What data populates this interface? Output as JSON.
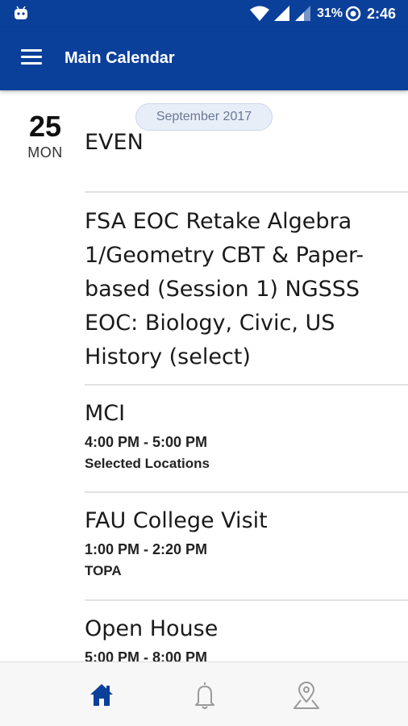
{
  "status_bar": {
    "battery": "31%",
    "time": "2:46"
  },
  "app_bar": {
    "title": "Main Calendar"
  },
  "calendar": {
    "month_label": "September 2017",
    "day": {
      "number": "25",
      "weekday": "MON"
    },
    "events": [
      {
        "title": "EVEN"
      },
      {
        "title": "FSA EOC Retake Algebra 1/Geometry CBT & Paper-based (Session 1) NGSSS EOC: Biology, Civic, US History (select)"
      },
      {
        "title": "MCI",
        "time": "4:00 PM - 5:00 PM",
        "location": "Selected Locations"
      },
      {
        "title": "FAU College Visit",
        "time": "1:00 PM - 2:20 PM",
        "location": "TOPA"
      },
      {
        "title": "Open House",
        "time": "5:00 PM - 8:00 PM"
      }
    ]
  },
  "bottom_nav": {
    "items": [
      "home-icon",
      "bell-icon",
      "map-pin-icon"
    ],
    "active_color": "#0a3f9a",
    "inactive_color": "#9a9a9a"
  },
  "colors": {
    "primary": "#0a3f9a",
    "pill_bg": "#e8eef8"
  }
}
